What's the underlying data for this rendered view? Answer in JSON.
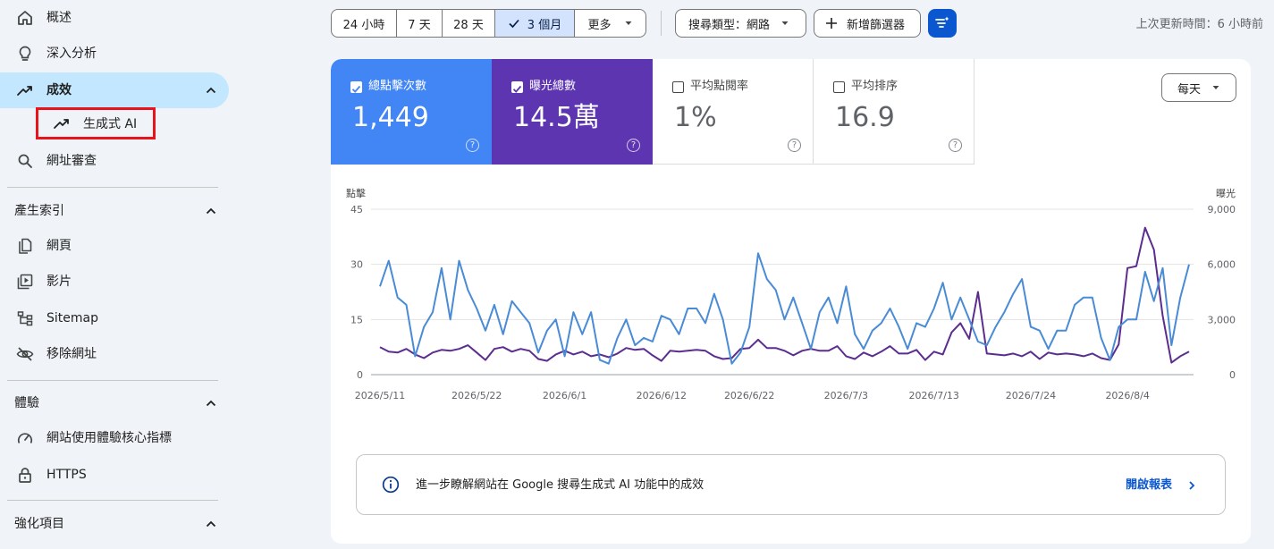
{
  "sidebar": {
    "items": [
      {
        "label": "概述"
      },
      {
        "label": "深入分析"
      },
      {
        "label": "成效"
      },
      {
        "label": "網址審查"
      },
      {
        "label": "網頁"
      },
      {
        "label": "影片"
      },
      {
        "label": "Sitemap"
      },
      {
        "label": "移除網址"
      },
      {
        "label": "網站使用體驗核心指標"
      },
      {
        "label": "HTTPS"
      }
    ],
    "sub_item": {
      "label": "生成式 AI"
    },
    "sections": [
      {
        "label": "產生索引"
      },
      {
        "label": "體驗"
      },
      {
        "label": "強化項目"
      }
    ]
  },
  "toolbar": {
    "ranges": [
      "24 小時",
      "7 天",
      "28 天",
      "3 個月"
    ],
    "selected_range": "3 個月",
    "more_label": "更多",
    "search_type_label": "搜尋類型：網路",
    "add_filter_label": "新增篩選器",
    "last_updated": "上次更新時間：6 小時前"
  },
  "metrics": [
    {
      "name": "總點擊次數",
      "value": "1,449",
      "checked": true,
      "color": "#4285f4"
    },
    {
      "name": "曝光總數",
      "value": "14.5萬",
      "checked": true,
      "color": "#5e35b1"
    },
    {
      "name": "平均點閱率",
      "value": "1%",
      "checked": false
    },
    {
      "name": "平均排序",
      "value": "16.9",
      "checked": false
    }
  ],
  "interval_select": "每天",
  "chart_data": {
    "type": "line",
    "left_axis_label": "點擊",
    "right_axis_label": "曝光",
    "left_ylim": [
      0,
      45
    ],
    "right_ylim": [
      0,
      9000
    ],
    "left_ticks": [
      "0",
      "15",
      "30",
      "45"
    ],
    "right_ticks": [
      "0",
      "3,000",
      "6,000",
      "9,000"
    ],
    "x_ticks": [
      "2026/5/11",
      "2026/5/22",
      "2026/6/1",
      "2026/6/12",
      "2026/6/22",
      "2026/7/3",
      "2026/7/13",
      "2026/7/24",
      "2026/8/4"
    ],
    "x_tick_day_index": [
      0,
      11,
      21,
      32,
      42,
      53,
      63,
      74,
      85
    ],
    "grid": true,
    "series": [
      {
        "name": "點擊",
        "axis": "left",
        "color": "#4a8bd6",
        "values": [
          24,
          31,
          21,
          19,
          5,
          13,
          17,
          29,
          15,
          31,
          23,
          18,
          12,
          19,
          11,
          20,
          17,
          14,
          6,
          12,
          15,
          5,
          17,
          11,
          17,
          4,
          3,
          10,
          15,
          8,
          10,
          9,
          16,
          15,
          11,
          18,
          18,
          14,
          22,
          15,
          3,
          6,
          13,
          33,
          26,
          23,
          15,
          21,
          14,
          7,
          17,
          21,
          14,
          24,
          11,
          7,
          12,
          14,
          18,
          13,
          7,
          14,
          13,
          18,
          25,
          15,
          21,
          15,
          9,
          8,
          13,
          17,
          22,
          26,
          13,
          12,
          7,
          12,
          12,
          19,
          21,
          21,
          10,
          4,
          13,
          15,
          15,
          28,
          20,
          29,
          8,
          21,
          30
        ]
      },
      {
        "name": "曝光",
        "axis": "right",
        "color": "#5b2d8e",
        "values": [
          1500,
          1250,
          1200,
          1400,
          1100,
          900,
          1200,
          1350,
          1300,
          1400,
          1600,
          1200,
          800,
          1400,
          1500,
          1250,
          1400,
          1300,
          850,
          750,
          1100,
          1300,
          1100,
          1250,
          1000,
          1100,
          950,
          1150,
          1450,
          1350,
          1400,
          1050,
          750,
          1300,
          1250,
          1300,
          1350,
          1300,
          1000,
          850,
          900,
          1400,
          1450,
          1900,
          1450,
          1450,
          1300,
          1050,
          1300,
          1400,
          1300,
          1300,
          1550,
          1000,
          850,
          1200,
          1000,
          1250,
          1550,
          1150,
          1150,
          1350,
          800,
          1250,
          1100,
          2300,
          2800,
          1950,
          4500,
          1150,
          1100,
          1050,
          1150,
          1000,
          1250,
          850,
          1200,
          1100,
          1150,
          1100,
          1000,
          1150,
          900,
          800,
          1650,
          5800,
          5900,
          8000,
          6800,
          3200,
          650,
          1000,
          1250
        ]
      }
    ]
  },
  "info_banner": {
    "text": "進一步瞭解網站在 Google 搜尋生成式 AI 功能中的成效",
    "link": "開啟報表"
  }
}
